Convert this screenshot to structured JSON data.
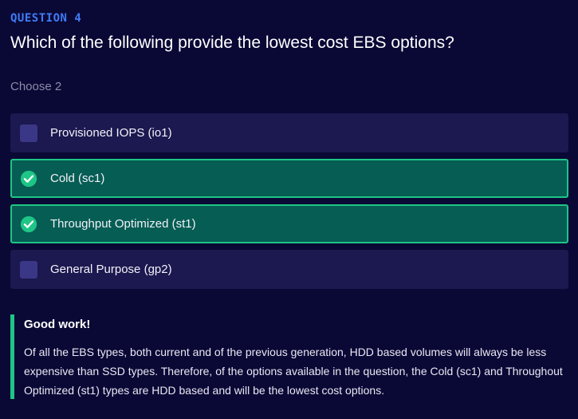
{
  "question": {
    "number_label": "QUESTION 4",
    "text": "Which of the following provide the lowest cost EBS options?",
    "instruction": "Choose 2"
  },
  "options": [
    {
      "label": "Provisioned IOPS (io1)",
      "selected": false
    },
    {
      "label": "Cold (sc1)",
      "selected": true
    },
    {
      "label": "Throughput Optimized (st1)",
      "selected": true
    },
    {
      "label": "General Purpose (gp2)",
      "selected": false
    }
  ],
  "feedback": {
    "title": "Good work!",
    "body": "Of all the EBS types, both current and of the previous generation, HDD based volumes will always be less expensive than SSD types. Therefore, of the options available in the question, the Cold (sc1) and Throughout Optimized (st1) types are HDD based and will be the lowest cost options."
  },
  "colors": {
    "background": "#0a0835",
    "accent_blue": "#3f7cf5",
    "option_bg": "#1c1850",
    "selected_bg": "#065d54",
    "selected_border": "#1ec586",
    "checkbox": "#3a3786"
  },
  "icons": {
    "checked": "check-circle-icon",
    "unchecked": "checkbox-icon"
  }
}
